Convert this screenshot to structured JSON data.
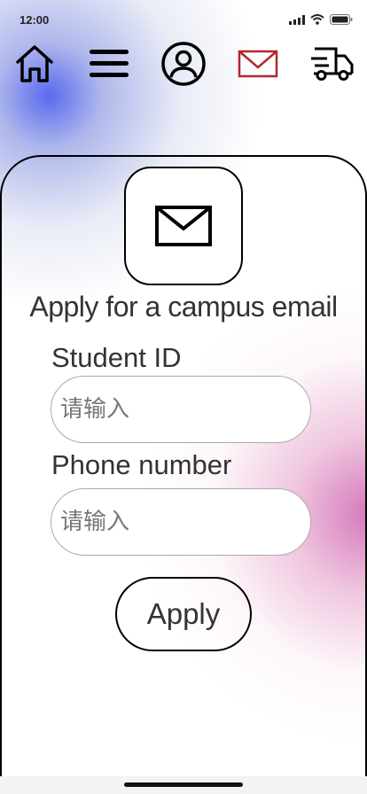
{
  "status_bar": {
    "time": "12:00"
  },
  "nav": {
    "items": [
      {
        "name": "home"
      },
      {
        "name": "menu"
      },
      {
        "name": "profile"
      },
      {
        "name": "mail",
        "active": true
      },
      {
        "name": "delivery"
      }
    ],
    "active_color": "#b3262d"
  },
  "form": {
    "title": "Apply for a campus email",
    "student_id_label": "Student ID",
    "student_id_placeholder": "请输入",
    "phone_label": "Phone number",
    "phone_placeholder": "请输入",
    "submit_label": "Apply"
  }
}
